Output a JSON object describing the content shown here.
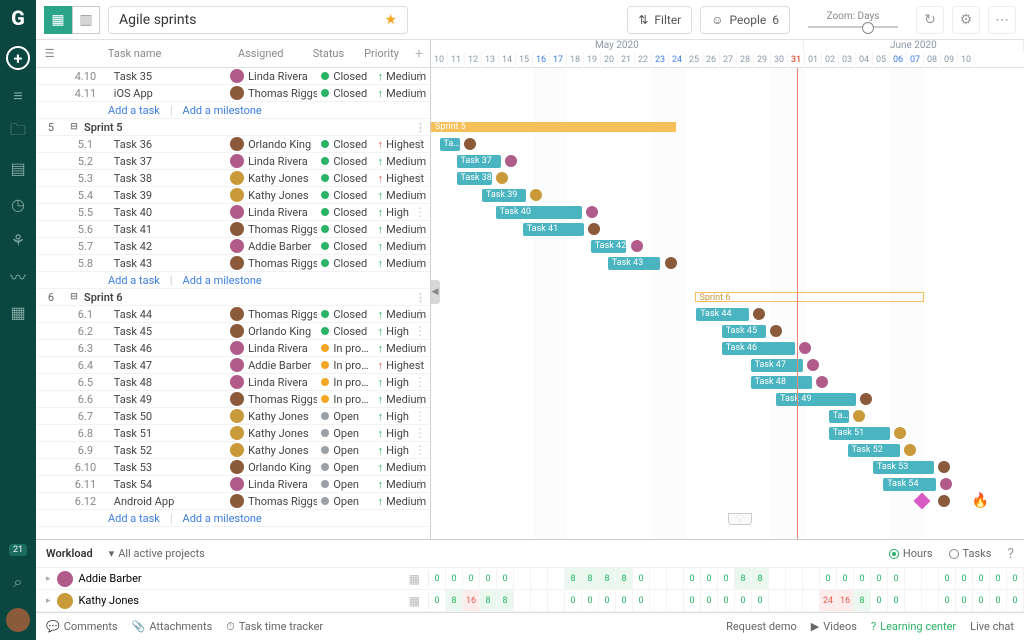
{
  "project": {
    "name": "Agile sprints"
  },
  "topbar": {
    "filter": "Filter",
    "people": "People",
    "people_count": "6",
    "zoom_label": "Zoom: Days"
  },
  "columns": {
    "name": "Task name",
    "assigned": "Assigned",
    "status": "Status",
    "priority": "Priority"
  },
  "statuses": {
    "closed": "Closed",
    "in_progress": "In pro…",
    "open": "Open"
  },
  "priorities": {
    "highest": "Highest",
    "high": "High",
    "medium": "Medium"
  },
  "add": {
    "task": "Add a task",
    "milestone": "Add a milestone"
  },
  "sprints": [
    {
      "idx": "5",
      "name": "Sprint 5"
    },
    {
      "idx": "6",
      "name": "Sprint 6"
    }
  ],
  "pre_tasks": [
    {
      "wbs": "4.10",
      "name": "Task 35",
      "assignee": "Linda Rivera",
      "status": "closed",
      "priority": "medium"
    },
    {
      "wbs": "4.11",
      "name": "iOS App",
      "assignee": "Thomas Riggs",
      "status": "closed",
      "priority": "medium"
    }
  ],
  "sprint5_tasks": [
    {
      "wbs": "5.1",
      "name": "Task 36",
      "assignee": "Orlando King",
      "status": "closed",
      "priority": "highest",
      "start": 0.5,
      "len": 1.2
    },
    {
      "wbs": "5.2",
      "name": "Task 37",
      "assignee": "Linda Rivera",
      "status": "closed",
      "priority": "medium",
      "start": 1.5,
      "len": 2.6
    },
    {
      "wbs": "5.3",
      "name": "Task 38",
      "assignee": "Kathy Jones",
      "status": "closed",
      "priority": "highest",
      "start": 1.5,
      "len": 2.1
    },
    {
      "wbs": "5.4",
      "name": "Task 39",
      "assignee": "Kathy Jones",
      "status": "closed",
      "priority": "medium",
      "start": 3.0,
      "len": 2.6
    },
    {
      "wbs": "5.5",
      "name": "Task 40",
      "assignee": "Linda Rivera",
      "status": "closed",
      "priority": "high",
      "start": 3.8,
      "len": 5.1
    },
    {
      "wbs": "5.6",
      "name": "Task 41",
      "assignee": "Thomas Riggs",
      "status": "closed",
      "priority": "medium",
      "start": 5.4,
      "len": 3.6
    },
    {
      "wbs": "5.7",
      "name": "Task 42",
      "assignee": "Addie Barber",
      "status": "closed",
      "priority": "medium",
      "start": 9.4,
      "len": 2.1
    },
    {
      "wbs": "5.8",
      "name": "Task 43",
      "assignee": "Thomas Riggs",
      "status": "closed",
      "priority": "medium",
      "start": 10.4,
      "len": 3.1
    }
  ],
  "sprint6_tasks": [
    {
      "wbs": "6.1",
      "name": "Task 44",
      "assignee": "Thomas Riggs",
      "status": "closed",
      "priority": "medium",
      "start": 15.6,
      "len": 3.1
    },
    {
      "wbs": "6.2",
      "name": "Task 45",
      "assignee": "Orlando King",
      "status": "closed",
      "priority": "high",
      "start": 17.1,
      "len": 2.6
    },
    {
      "wbs": "6.3",
      "name": "Task 46",
      "assignee": "Linda Rivera",
      "status": "in_progress",
      "priority": "medium",
      "start": 17.1,
      "len": 4.3
    },
    {
      "wbs": "6.4",
      "name": "Task 47",
      "assignee": "Addie Barber",
      "status": "in_progress",
      "priority": "highest",
      "start": 18.8,
      "len": 3.1
    },
    {
      "wbs": "6.5",
      "name": "Task 48",
      "assignee": "Linda Rivera",
      "status": "in_progress",
      "priority": "high",
      "start": 18.8,
      "len": 3.6
    },
    {
      "wbs": "6.6",
      "name": "Task 49",
      "assignee": "Thomas Riggs",
      "status": "in_progress",
      "priority": "medium",
      "start": 20.3,
      "len": 4.7
    },
    {
      "wbs": "6.7",
      "name": "Task 50",
      "assignee": "Kathy Jones",
      "status": "open",
      "priority": "high",
      "start": 23.4,
      "len": 1.2
    },
    {
      "wbs": "6.8",
      "name": "Task 51",
      "assignee": "Kathy Jones",
      "status": "open",
      "priority": "high",
      "start": 23.4,
      "len": 3.6
    },
    {
      "wbs": "6.9",
      "name": "Task 52",
      "assignee": "Kathy Jones",
      "status": "open",
      "priority": "high",
      "start": 24.5,
      "len": 3.1
    },
    {
      "wbs": "6.10",
      "name": "Task 53",
      "assignee": "Orlando King",
      "status": "open",
      "priority": "medium",
      "start": 26.0,
      "len": 3.6
    },
    {
      "wbs": "6.11",
      "name": "Task 54",
      "assignee": "Linda Rivera",
      "status": "open",
      "priority": "medium",
      "start": 26.6,
      "len": 3.1
    },
    {
      "wbs": "6.12",
      "name": "Android App",
      "assignee": "Thomas Riggs",
      "status": "open",
      "priority": "medium"
    }
  ],
  "timeline": {
    "months": [
      {
        "label": "May 2020",
        "span": 22,
        "offset": 0
      },
      {
        "label": "June 2020",
        "span": 13,
        "offset": 22
      }
    ],
    "days": [
      "10",
      "11",
      "12",
      "13",
      "14",
      "15",
      "16",
      "17",
      "18",
      "19",
      "20",
      "21",
      "22",
      "23",
      "24",
      "25",
      "26",
      "27",
      "28",
      "29",
      "30",
      "31",
      "01",
      "02",
      "03",
      "04",
      "05",
      "06",
      "07",
      "08",
      "09",
      "10"
    ],
    "today_index": 21,
    "weekend_indices": [
      6,
      13,
      20,
      27
    ],
    "blue_day_indices": [
      6,
      7,
      13,
      14,
      27,
      28
    ],
    "sprint5": {
      "label": "Sprint 5",
      "start": 0,
      "len": 14.4
    },
    "sprint6": {
      "label": "Sprint 6",
      "start": 15.5,
      "len": 13.5
    }
  },
  "workload": {
    "title": "Workload",
    "filter": "All active projects",
    "hours": "Hours",
    "tasks": "Tasks",
    "users": [
      {
        "name": "Addie Barber",
        "cells": [
          {
            "v": "0"
          },
          {
            "v": "0"
          },
          {
            "v": "0"
          },
          {
            "v": "0"
          },
          {
            "v": "0"
          },
          {
            "v": ""
          },
          {
            "v": ""
          },
          {
            "v": ""
          },
          {
            "v": "8",
            "c": "g"
          },
          {
            "v": "8",
            "c": "g"
          },
          {
            "v": "8",
            "c": "g"
          },
          {
            "v": "8",
            "c": "g"
          },
          {
            "v": "0"
          },
          {
            "v": ""
          },
          {
            "v": ""
          },
          {
            "v": "0"
          },
          {
            "v": "0"
          },
          {
            "v": "0"
          },
          {
            "v": "8",
            "c": "g"
          },
          {
            "v": "8",
            "c": "g"
          },
          {
            "v": ""
          },
          {
            "v": ""
          },
          {
            "v": ""
          },
          {
            "v": "0"
          },
          {
            "v": "0"
          },
          {
            "v": "0"
          },
          {
            "v": "0"
          },
          {
            "v": "0"
          },
          {
            "v": ""
          },
          {
            "v": ""
          },
          {
            "v": "0"
          },
          {
            "v": "0"
          },
          {
            "v": "0"
          },
          {
            "v": "0"
          },
          {
            "v": "0"
          }
        ]
      },
      {
        "name": "Kathy Jones",
        "cells": [
          {
            "v": "0"
          },
          {
            "v": "8",
            "c": "g"
          },
          {
            "v": "16",
            "c": "r"
          },
          {
            "v": "8",
            "c": "g"
          },
          {
            "v": "8",
            "c": "g"
          },
          {
            "v": ""
          },
          {
            "v": ""
          },
          {
            "v": ""
          },
          {
            "v": "0"
          },
          {
            "v": "0"
          },
          {
            "v": "0"
          },
          {
            "v": "0"
          },
          {
            "v": "0"
          },
          {
            "v": ""
          },
          {
            "v": ""
          },
          {
            "v": "0"
          },
          {
            "v": "0"
          },
          {
            "v": "0"
          },
          {
            "v": "0"
          },
          {
            "v": "0"
          },
          {
            "v": ""
          },
          {
            "v": ""
          },
          {
            "v": ""
          },
          {
            "v": "24",
            "c": "r"
          },
          {
            "v": "16",
            "c": "r"
          },
          {
            "v": "8",
            "c": "g"
          },
          {
            "v": "0"
          },
          {
            "v": "0"
          },
          {
            "v": ""
          },
          {
            "v": ""
          },
          {
            "v": "0"
          },
          {
            "v": "0"
          },
          {
            "v": "0"
          },
          {
            "v": "0"
          },
          {
            "v": "0"
          }
        ]
      }
    ]
  },
  "notif_count": "21",
  "footer": {
    "comments": "Comments",
    "attachments": "Attachments",
    "timer": "Task time tracker",
    "demo": "Request demo",
    "videos": "Videos",
    "learning": "Learning center",
    "chat": "Live chat"
  },
  "colors": {
    "av": [
      "#8a5a3a",
      "#4a78b8",
      "#c99a3a",
      "#b05b8a",
      "#5aa06a",
      "#7a5aa0"
    ]
  }
}
